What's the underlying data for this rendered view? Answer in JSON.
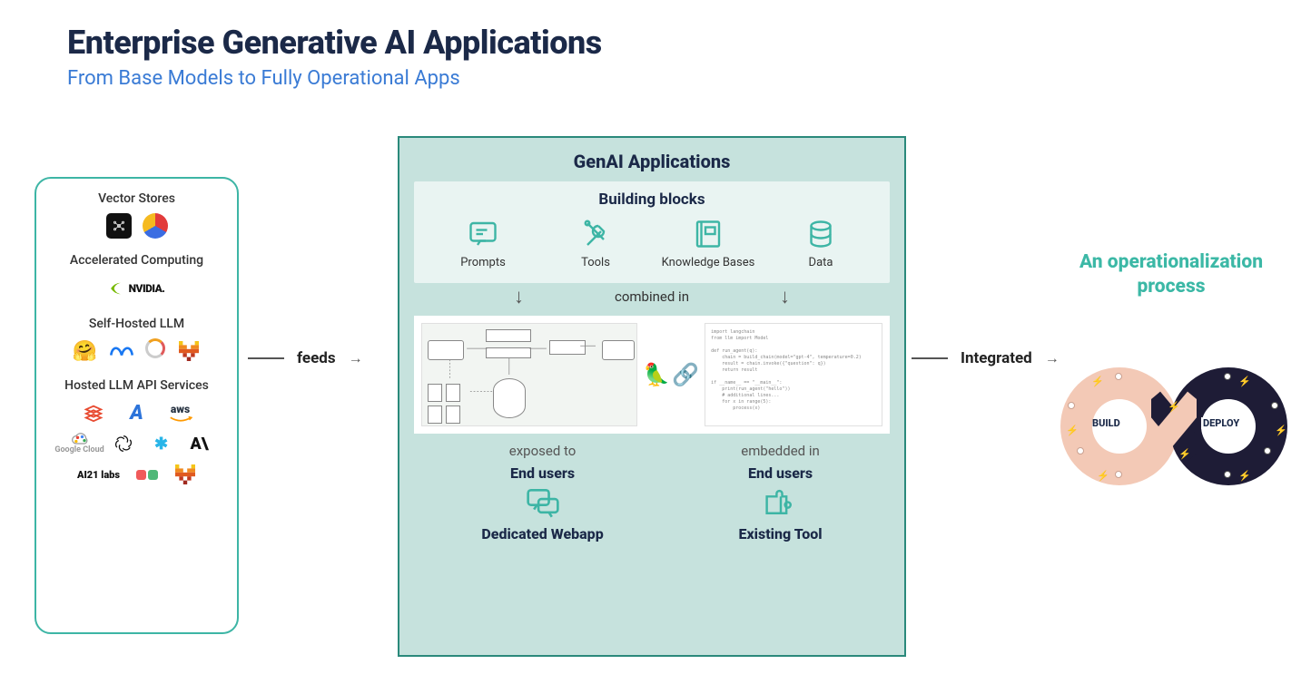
{
  "title": "Enterprise Generative AI Applications",
  "subtitle": "From Base Models to Fully Operational Apps",
  "left_box": {
    "sections": [
      {
        "heading": "Vector Stores",
        "logos": [
          "pinecone-icon",
          "chroma-icon"
        ]
      },
      {
        "heading": "Accelerated Computing",
        "logos": [
          "nvidia-logo"
        ]
      },
      {
        "heading": "Self-Hosted LLM",
        "logos": [
          "huggingface-icon",
          "meta-icon",
          "ring-icon",
          "mistral-icon"
        ]
      },
      {
        "heading": "Hosted LLM API Services",
        "logos": [
          "databricks-icon",
          "azure-icon",
          "aws-icon",
          "gcloud-icon",
          "openai-icon",
          "snowflake-icon",
          "anthropic-icon",
          "ai21-icon",
          "blobs-icon",
          "mistral-icon"
        ]
      }
    ]
  },
  "connector_left": "feeds",
  "center": {
    "title": "GenAI Applications",
    "building_blocks_title": "Building blocks",
    "blocks": [
      {
        "name": "prompts-icon",
        "label": "Prompts"
      },
      {
        "name": "tools-icon",
        "label": "Tools"
      },
      {
        "name": "knowledge-bases-icon",
        "label": "Knowledge Bases"
      },
      {
        "name": "data-icon",
        "label": "Data"
      }
    ],
    "combined_label": "combined in",
    "exposed": {
      "left_pre": "exposed to",
      "left_bold": "End users",
      "left_app": "Dedicated Webapp",
      "right_pre": "embedded in",
      "right_bold": "End users",
      "right_app": "Existing Tool"
    }
  },
  "connector_right": "Integrated",
  "right": {
    "title": "An operationalization process",
    "left_label": "BUILD",
    "right_label": "DEPLOY"
  }
}
